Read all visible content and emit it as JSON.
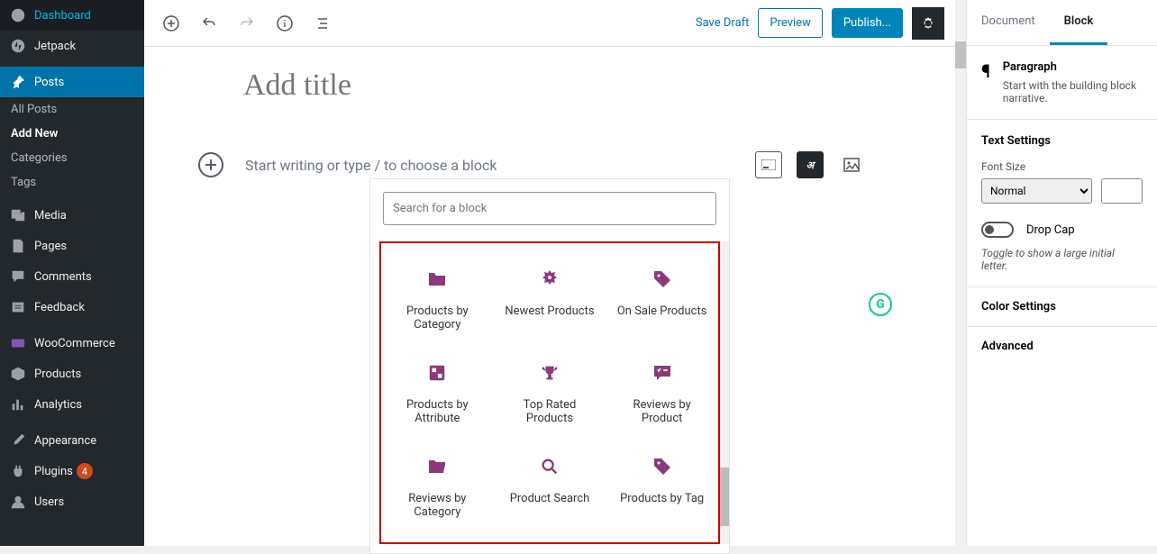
{
  "sidebar": {
    "items": [
      {
        "label": "Dashboard"
      },
      {
        "label": "Jetpack"
      },
      {
        "label": "Posts"
      },
      {
        "label": "Media"
      },
      {
        "label": "Pages"
      },
      {
        "label": "Comments"
      },
      {
        "label": "Feedback"
      },
      {
        "label": "WooCommerce"
      },
      {
        "label": "Products"
      },
      {
        "label": "Analytics"
      },
      {
        "label": "Appearance"
      },
      {
        "label": "Plugins",
        "badge": "4"
      },
      {
        "label": "Users"
      }
    ],
    "subs": [
      {
        "label": "All Posts"
      },
      {
        "label": "Add New"
      },
      {
        "label": "Categories"
      },
      {
        "label": "Tags"
      }
    ]
  },
  "topbar": {
    "save": "Save Draft",
    "preview": "Preview",
    "publish": "Publish..."
  },
  "editor": {
    "title_placeholder": "Add title",
    "block_placeholder": "Start writing or type / to choose a block"
  },
  "inserter": {
    "search_placeholder": "Search for a block",
    "blocks": [
      {
        "label": "Products by Category"
      },
      {
        "label": "Newest Products"
      },
      {
        "label": "On Sale Products"
      },
      {
        "label": "Products by Attribute"
      },
      {
        "label": "Top Rated Products"
      },
      {
        "label": "Reviews by Product"
      },
      {
        "label": "Reviews by Category"
      },
      {
        "label": "Product Search"
      },
      {
        "label": "Products by Tag"
      }
    ]
  },
  "right": {
    "tabs": {
      "doc": "Document",
      "block": "Block"
    },
    "block_name": "Paragraph",
    "block_desc": "Start with the building block narrative.",
    "text_settings": "Text Settings",
    "font_size": "Font Size",
    "font_value": "Normal",
    "drop_cap": "Drop Cap",
    "drop_help": "Toggle to show a large initial letter.",
    "color": "Color Settings",
    "advanced": "Advanced"
  }
}
